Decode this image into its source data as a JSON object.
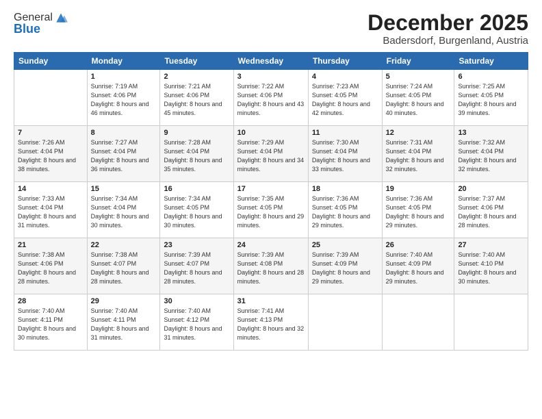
{
  "logo": {
    "general": "General",
    "blue": "Blue"
  },
  "title": "December 2025",
  "location": "Badersdorf, Burgenland, Austria",
  "days_header": [
    "Sunday",
    "Monday",
    "Tuesday",
    "Wednesday",
    "Thursday",
    "Friday",
    "Saturday"
  ],
  "weeks": [
    [
      {
        "num": "",
        "sunrise": "",
        "sunset": "",
        "daylight": ""
      },
      {
        "num": "1",
        "sunrise": "Sunrise: 7:19 AM",
        "sunset": "Sunset: 4:06 PM",
        "daylight": "Daylight: 8 hours and 46 minutes."
      },
      {
        "num": "2",
        "sunrise": "Sunrise: 7:21 AM",
        "sunset": "Sunset: 4:06 PM",
        "daylight": "Daylight: 8 hours and 45 minutes."
      },
      {
        "num": "3",
        "sunrise": "Sunrise: 7:22 AM",
        "sunset": "Sunset: 4:06 PM",
        "daylight": "Daylight: 8 hours and 43 minutes."
      },
      {
        "num": "4",
        "sunrise": "Sunrise: 7:23 AM",
        "sunset": "Sunset: 4:05 PM",
        "daylight": "Daylight: 8 hours and 42 minutes."
      },
      {
        "num": "5",
        "sunrise": "Sunrise: 7:24 AM",
        "sunset": "Sunset: 4:05 PM",
        "daylight": "Daylight: 8 hours and 40 minutes."
      },
      {
        "num": "6",
        "sunrise": "Sunrise: 7:25 AM",
        "sunset": "Sunset: 4:05 PM",
        "daylight": "Daylight: 8 hours and 39 minutes."
      }
    ],
    [
      {
        "num": "7",
        "sunrise": "Sunrise: 7:26 AM",
        "sunset": "Sunset: 4:04 PM",
        "daylight": "Daylight: 8 hours and 38 minutes."
      },
      {
        "num": "8",
        "sunrise": "Sunrise: 7:27 AM",
        "sunset": "Sunset: 4:04 PM",
        "daylight": "Daylight: 8 hours and 36 minutes."
      },
      {
        "num": "9",
        "sunrise": "Sunrise: 7:28 AM",
        "sunset": "Sunset: 4:04 PM",
        "daylight": "Daylight: 8 hours and 35 minutes."
      },
      {
        "num": "10",
        "sunrise": "Sunrise: 7:29 AM",
        "sunset": "Sunset: 4:04 PM",
        "daylight": "Daylight: 8 hours and 34 minutes."
      },
      {
        "num": "11",
        "sunrise": "Sunrise: 7:30 AM",
        "sunset": "Sunset: 4:04 PM",
        "daylight": "Daylight: 8 hours and 33 minutes."
      },
      {
        "num": "12",
        "sunrise": "Sunrise: 7:31 AM",
        "sunset": "Sunset: 4:04 PM",
        "daylight": "Daylight: 8 hours and 32 minutes."
      },
      {
        "num": "13",
        "sunrise": "Sunrise: 7:32 AM",
        "sunset": "Sunset: 4:04 PM",
        "daylight": "Daylight: 8 hours and 32 minutes."
      }
    ],
    [
      {
        "num": "14",
        "sunrise": "Sunrise: 7:33 AM",
        "sunset": "Sunset: 4:04 PM",
        "daylight": "Daylight: 8 hours and 31 minutes."
      },
      {
        "num": "15",
        "sunrise": "Sunrise: 7:34 AM",
        "sunset": "Sunset: 4:04 PM",
        "daylight": "Daylight: 8 hours and 30 minutes."
      },
      {
        "num": "16",
        "sunrise": "Sunrise: 7:34 AM",
        "sunset": "Sunset: 4:05 PM",
        "daylight": "Daylight: 8 hours and 30 minutes."
      },
      {
        "num": "17",
        "sunrise": "Sunrise: 7:35 AM",
        "sunset": "Sunset: 4:05 PM",
        "daylight": "Daylight: 8 hours and 29 minutes."
      },
      {
        "num": "18",
        "sunrise": "Sunrise: 7:36 AM",
        "sunset": "Sunset: 4:05 PM",
        "daylight": "Daylight: 8 hours and 29 minutes."
      },
      {
        "num": "19",
        "sunrise": "Sunrise: 7:36 AM",
        "sunset": "Sunset: 4:05 PM",
        "daylight": "Daylight: 8 hours and 29 minutes."
      },
      {
        "num": "20",
        "sunrise": "Sunrise: 7:37 AM",
        "sunset": "Sunset: 4:06 PM",
        "daylight": "Daylight: 8 hours and 28 minutes."
      }
    ],
    [
      {
        "num": "21",
        "sunrise": "Sunrise: 7:38 AM",
        "sunset": "Sunset: 4:06 PM",
        "daylight": "Daylight: 8 hours and 28 minutes."
      },
      {
        "num": "22",
        "sunrise": "Sunrise: 7:38 AM",
        "sunset": "Sunset: 4:07 PM",
        "daylight": "Daylight: 8 hours and 28 minutes."
      },
      {
        "num": "23",
        "sunrise": "Sunrise: 7:39 AM",
        "sunset": "Sunset: 4:07 PM",
        "daylight": "Daylight: 8 hours and 28 minutes."
      },
      {
        "num": "24",
        "sunrise": "Sunrise: 7:39 AM",
        "sunset": "Sunset: 4:08 PM",
        "daylight": "Daylight: 8 hours and 28 minutes."
      },
      {
        "num": "25",
        "sunrise": "Sunrise: 7:39 AM",
        "sunset": "Sunset: 4:09 PM",
        "daylight": "Daylight: 8 hours and 29 minutes."
      },
      {
        "num": "26",
        "sunrise": "Sunrise: 7:40 AM",
        "sunset": "Sunset: 4:09 PM",
        "daylight": "Daylight: 8 hours and 29 minutes."
      },
      {
        "num": "27",
        "sunrise": "Sunrise: 7:40 AM",
        "sunset": "Sunset: 4:10 PM",
        "daylight": "Daylight: 8 hours and 30 minutes."
      }
    ],
    [
      {
        "num": "28",
        "sunrise": "Sunrise: 7:40 AM",
        "sunset": "Sunset: 4:11 PM",
        "daylight": "Daylight: 8 hours and 30 minutes."
      },
      {
        "num": "29",
        "sunrise": "Sunrise: 7:40 AM",
        "sunset": "Sunset: 4:11 PM",
        "daylight": "Daylight: 8 hours and 31 minutes."
      },
      {
        "num": "30",
        "sunrise": "Sunrise: 7:40 AM",
        "sunset": "Sunset: 4:12 PM",
        "daylight": "Daylight: 8 hours and 31 minutes."
      },
      {
        "num": "31",
        "sunrise": "Sunrise: 7:41 AM",
        "sunset": "Sunset: 4:13 PM",
        "daylight": "Daylight: 8 hours and 32 minutes."
      },
      {
        "num": "",
        "sunrise": "",
        "sunset": "",
        "daylight": ""
      },
      {
        "num": "",
        "sunrise": "",
        "sunset": "",
        "daylight": ""
      },
      {
        "num": "",
        "sunrise": "",
        "sunset": "",
        "daylight": ""
      }
    ]
  ]
}
